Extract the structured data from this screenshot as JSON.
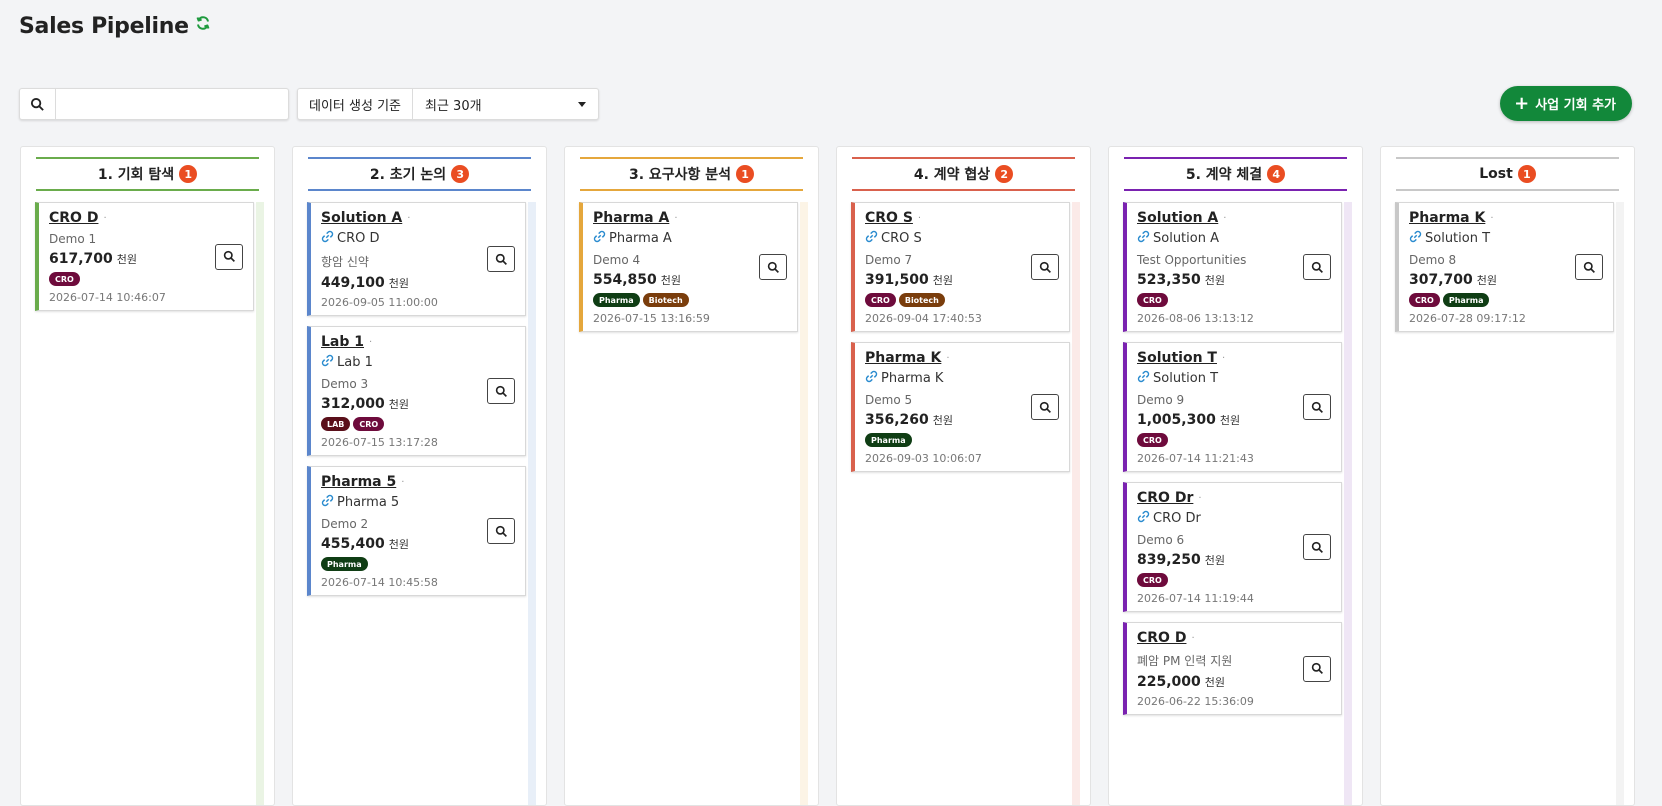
{
  "header": {
    "title": "Sales Pipeline",
    "refresh_icon": "refresh-icon"
  },
  "toolbar": {
    "search_placeholder": "",
    "search_value": "",
    "filter_label": "데이터 생성 기준",
    "filter_value": "최근 30개",
    "add_button_label": "사업 기회 추가"
  },
  "tag_colors": {
    "CRO": "#6e0b3c",
    "Pharma": "#0f3d14",
    "Biotech": "#7a3d0c",
    "LAB": "#5a0f1a"
  },
  "columns": [
    {
      "title": "1. 기회 탐색",
      "count": "1",
      "color": "#6aac4c",
      "track": "#eaf4e4",
      "cards": [
        {
          "title": "CRO D",
          "company": "",
          "desc": "Demo 1",
          "amount": "617,700",
          "unit": "천원",
          "tags": [
            "CRO"
          ],
          "date": "2026-07-14 10:46:07"
        }
      ]
    },
    {
      "title": "2. 초기 논의",
      "count": "3",
      "color": "#5b86cc",
      "track": "#e8eff8",
      "cards": [
        {
          "title": "Solution A",
          "company": "CRO D",
          "desc": "항암 신약",
          "amount": "449,100",
          "unit": "천원",
          "tags": [],
          "date": "2026-09-05 11:00:00"
        },
        {
          "title": "Lab 1",
          "company": "Lab 1",
          "desc": "Demo 3",
          "amount": "312,000",
          "unit": "천원",
          "tags": [
            "LAB",
            "CRO"
          ],
          "date": "2026-07-15 13:17:28"
        },
        {
          "title": "Pharma 5",
          "company": "Pharma 5",
          "desc": "Demo 2",
          "amount": "455,400",
          "unit": "천원",
          "tags": [
            "Pharma"
          ],
          "date": "2026-07-14 10:45:58"
        }
      ]
    },
    {
      "title": "3. 요구사항 분석",
      "count": "1",
      "color": "#e5a73c",
      "track": "#fcf4e6",
      "cards": [
        {
          "title": "Pharma A",
          "company": "Pharma A",
          "desc": "Demo 4",
          "amount": "554,850",
          "unit": "천원",
          "tags": [
            "Pharma",
            "Biotech"
          ],
          "date": "2026-07-15 13:16:59"
        }
      ]
    },
    {
      "title": "4. 계약 협상",
      "count": "2",
      "color": "#d9614d",
      "track": "#fbeae8",
      "cards": [
        {
          "title": "CRO S",
          "company": "CRO S",
          "desc": "Demo 7",
          "amount": "391,500",
          "unit": "천원",
          "tags": [
            "CRO",
            "Biotech"
          ],
          "date": "2026-09-04 17:40:53"
        },
        {
          "title": "Pharma K",
          "company": "Pharma K",
          "desc": "Demo 5",
          "amount": "356,260",
          "unit": "천원",
          "tags": [
            "Pharma"
          ],
          "date": "2026-09-03 10:06:07"
        }
      ]
    },
    {
      "title": "5. 계약 체결",
      "count": "4",
      "color": "#7a22b0",
      "track": "#efe6f5",
      "cards": [
        {
          "title": "Solution A",
          "company": "Solution A",
          "desc": "Test Opportunities",
          "amount": "523,350",
          "unit": "천원",
          "tags": [
            "CRO"
          ],
          "date": "2026-08-06 13:13:12"
        },
        {
          "title": "Solution T",
          "company": "Solution T",
          "desc": "Demo 9",
          "amount": "1,005,300",
          "unit": "천원",
          "tags": [
            "CRO"
          ],
          "date": "2026-07-14 11:21:43"
        },
        {
          "title": "CRO Dr",
          "company": "CRO Dr",
          "desc": "Demo 6",
          "amount": "839,250",
          "unit": "천원",
          "tags": [
            "CRO"
          ],
          "date": "2026-07-14 11:19:44"
        },
        {
          "title": "CRO D",
          "company": "",
          "desc": "폐암 PM 인력 지원",
          "amount": "225,000",
          "unit": "천원",
          "tags": [],
          "date": "2026-06-22 15:36:09"
        }
      ]
    },
    {
      "title": "Lost",
      "count": "1",
      "color": "#c8c8c8",
      "track": "#f3f3f3",
      "cards": [
        {
          "title": "Pharma K",
          "company": "Solution T",
          "desc": "Demo 8",
          "amount": "307,700",
          "unit": "천원",
          "tags": [
            "CRO",
            "Pharma"
          ],
          "date": "2026-07-28 09:17:12"
        }
      ]
    }
  ]
}
